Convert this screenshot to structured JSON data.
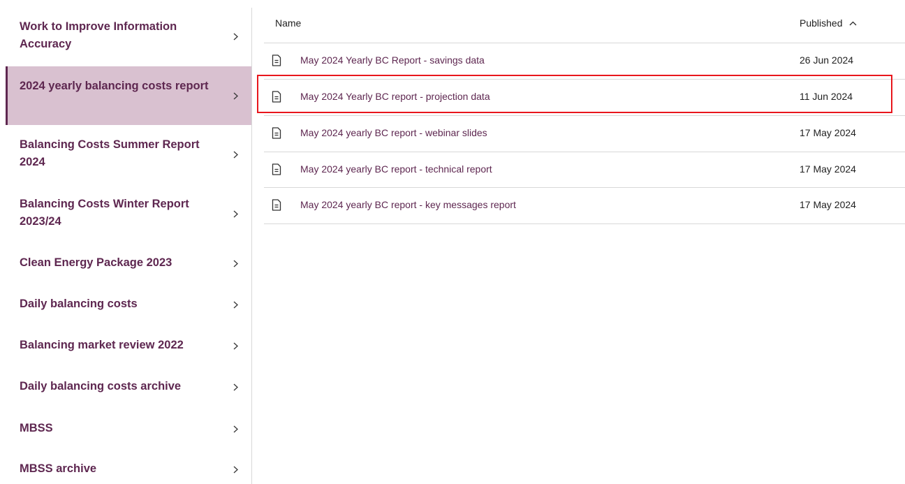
{
  "sidebar": {
    "items": [
      {
        "label": "Work to Improve Information Accuracy",
        "active": false
      },
      {
        "label": "2024 yearly balancing costs report",
        "active": true
      },
      {
        "label": "Balancing Costs Summer Report 2024",
        "active": false
      },
      {
        "label": "Balancing Costs Winter Report 2023/24",
        "active": false
      },
      {
        "label": "Clean Energy Package 2023",
        "active": false
      },
      {
        "label": "Daily balancing costs",
        "active": false
      },
      {
        "label": "Balancing market review 2022",
        "active": false
      },
      {
        "label": "Daily balancing costs archive",
        "active": false
      },
      {
        "label": "MBSS",
        "active": false
      },
      {
        "label": "MBSS archive",
        "active": false
      }
    ],
    "chevron_icon": "chevron-right-icon"
  },
  "table": {
    "header": {
      "name": "Name",
      "published": "Published",
      "sort_icon": "chevron-up-icon"
    },
    "rows": [
      {
        "name": "May 2024 Yearly BC Report - savings data",
        "published": "26 Jun 2024",
        "icon": "document-icon"
      },
      {
        "name": "May 2024 Yearly BC report - projection data",
        "published": "11 Jun 2024",
        "icon": "document-icon",
        "highlighted": true
      },
      {
        "name": "May 2024 yearly BC report - webinar slides",
        "published": "17 May 2024",
        "icon": "document-icon"
      },
      {
        "name": "May 2024 yearly BC report - technical report",
        "published": "17 May 2024",
        "icon": "document-icon"
      },
      {
        "name": "May 2024 yearly BC report - key messages report",
        "published": "17 May 2024",
        "icon": "document-icon"
      }
    ]
  },
  "colors": {
    "brand": "#5e2750",
    "active_bg": "#d9c1d0",
    "highlight": "#e8161c",
    "divider": "#d8d8d8"
  }
}
